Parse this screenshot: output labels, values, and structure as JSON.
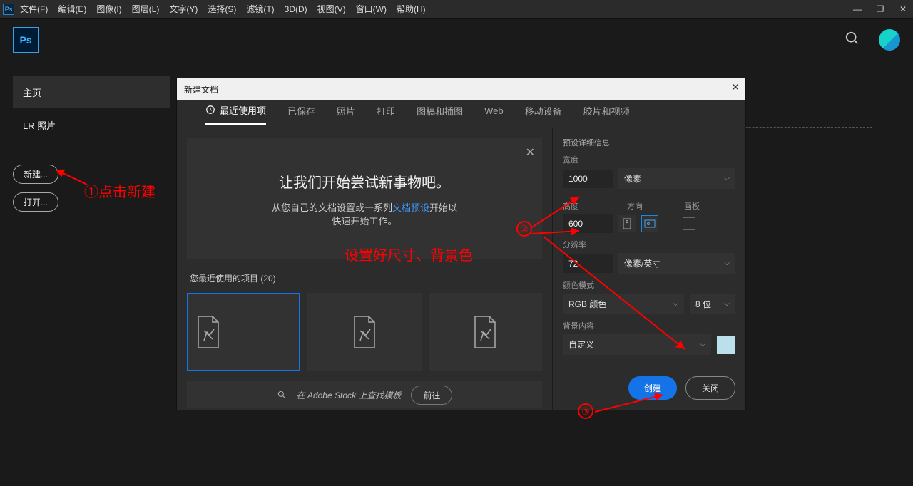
{
  "menubar": {
    "items": [
      "文件(F)",
      "编辑(E)",
      "图像(I)",
      "图层(L)",
      "文字(Y)",
      "选择(S)",
      "滤镜(T)",
      "3D(D)",
      "视图(V)",
      "窗口(W)",
      "帮助(H)"
    ]
  },
  "left": {
    "home": "主页",
    "lr": "LR 照片",
    "new_btn": "新建...",
    "open_btn": "打开..."
  },
  "dialog": {
    "title": "新建文档",
    "tabs": [
      "最近使用项",
      "已保存",
      "照片",
      "打印",
      "图稿和插图",
      "Web",
      "移动设备",
      "胶片和视频"
    ],
    "banner": {
      "heading": "让我们开始尝试新事物吧。",
      "line2a": "从您自己的文档设置或一系列",
      "line2link": "文档预设",
      "line2b": "开始以",
      "line3": "快速开始工作。"
    },
    "recent_label": "您最近使用的项目 (20)",
    "stock": {
      "placeholder": "在 Adobe Stock 上查找模板",
      "go": "前往"
    },
    "panel": {
      "heading": "预设详细信息",
      "width_lbl": "宽度",
      "width_val": "1000",
      "width_unit": "像素",
      "height_lbl": "高度",
      "orient_lbl": "方向",
      "artboard_lbl": "画板",
      "height_val": "600",
      "res_lbl": "分辨率",
      "res_val": "72",
      "res_unit": "像素/英寸",
      "mode_lbl": "颜色模式",
      "mode_val": "RGB 颜色",
      "bits": "8 位",
      "bg_lbl": "背景内容",
      "bg_val": "自定义",
      "create": "创建",
      "close": "关闭"
    }
  },
  "annotations": {
    "a1": "①点击新建",
    "a2": "设置好尺寸、背景色",
    "n2": "②",
    "n3": "③"
  }
}
